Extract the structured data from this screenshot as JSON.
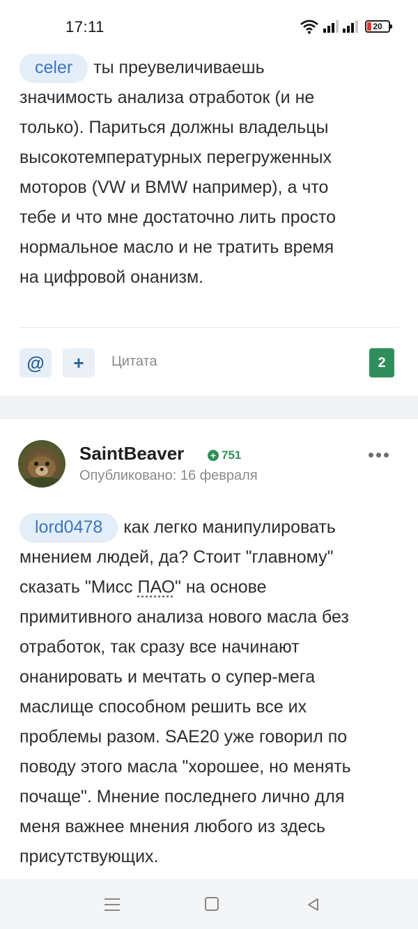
{
  "status_bar": {
    "time": "17:11",
    "battery": "20",
    "icons": [
      "wifi-icon",
      "signal-icon",
      "signal-icon",
      "battery-icon"
    ]
  },
  "post1": {
    "mention": "celer",
    "text_lines": [
      "ты преувеличиваешь",
      "значимость анализа отработок (и не",
      "только). Париться должны владельцы",
      "высокотемпературных перегруженных",
      "моторов (VW и BMW например), а что",
      "тебе и что мне достаточно лить просто",
      "нормальное масло и не тратить время",
      "на цифровой онанизм."
    ]
  },
  "actions": {
    "mention_icon": "@",
    "plus_icon": "+",
    "quote_label": "Цитата",
    "reputation_count": "2"
  },
  "post2": {
    "author": "SaintBeaver",
    "reputation": "751",
    "published": "Опубликовано: 16 февраля",
    "mention": "lord0478",
    "first_line": "как легко манипулировать",
    "line2": "мнением людей, да? Стоит \"главному\"",
    "line3_before": "сказать \"Мисс ",
    "line3_abbr": "ПАО",
    "line3_after": "\" на основе",
    "text_lines": [
      "примитивного анализа нового масла без",
      "отработок, так сразу все начинают",
      "онанировать и мечтать о супер-мега",
      "маслище способном решить все их",
      "проблемы разом. SAE20 уже говорил по",
      "поводу этого масла \"хорошее, но менять",
      "почаще\". Мнение последнего лично для",
      "меня важнее мнения любого из здесь",
      "присутствующих."
    ]
  },
  "colors": {
    "accent_blue": "#3b76bd",
    "mention_bg": "#e3eef9",
    "reputation_green": "#2f8f5b"
  }
}
